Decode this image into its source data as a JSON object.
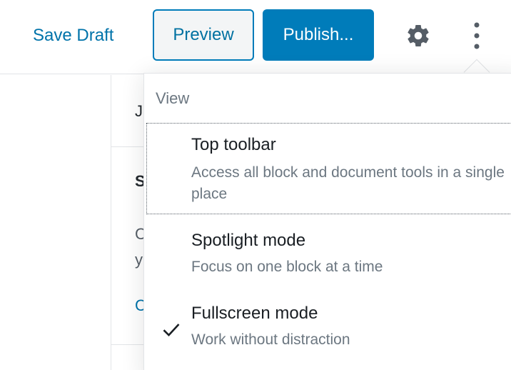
{
  "header": {
    "save_draft_label": "Save Draft",
    "preview_label": "Preview",
    "publish_label": "Publish...",
    "settings_icon": "gear-icon",
    "more_icon": "vertical-ellipsis-icon"
  },
  "sidebar": {
    "tab_fragment": "J",
    "heading_fragment": "S",
    "line1_fragment": "C",
    "line2_fragment": "y",
    "link_fragment": "C"
  },
  "menu": {
    "group_label": "View",
    "items": [
      {
        "title": "Top toolbar",
        "description": "Access all block and document tools in a single place",
        "checked": false
      },
      {
        "title": "Spotlight mode",
        "description": "Focus on one block at a time",
        "checked": false
      },
      {
        "title": "Fullscreen mode",
        "description": "Work without distraction",
        "checked": true
      }
    ]
  },
  "colors": {
    "accent": "#007cba",
    "link": "#0073aa",
    "text_primary": "#191e23",
    "text_secondary": "#6c7781"
  }
}
